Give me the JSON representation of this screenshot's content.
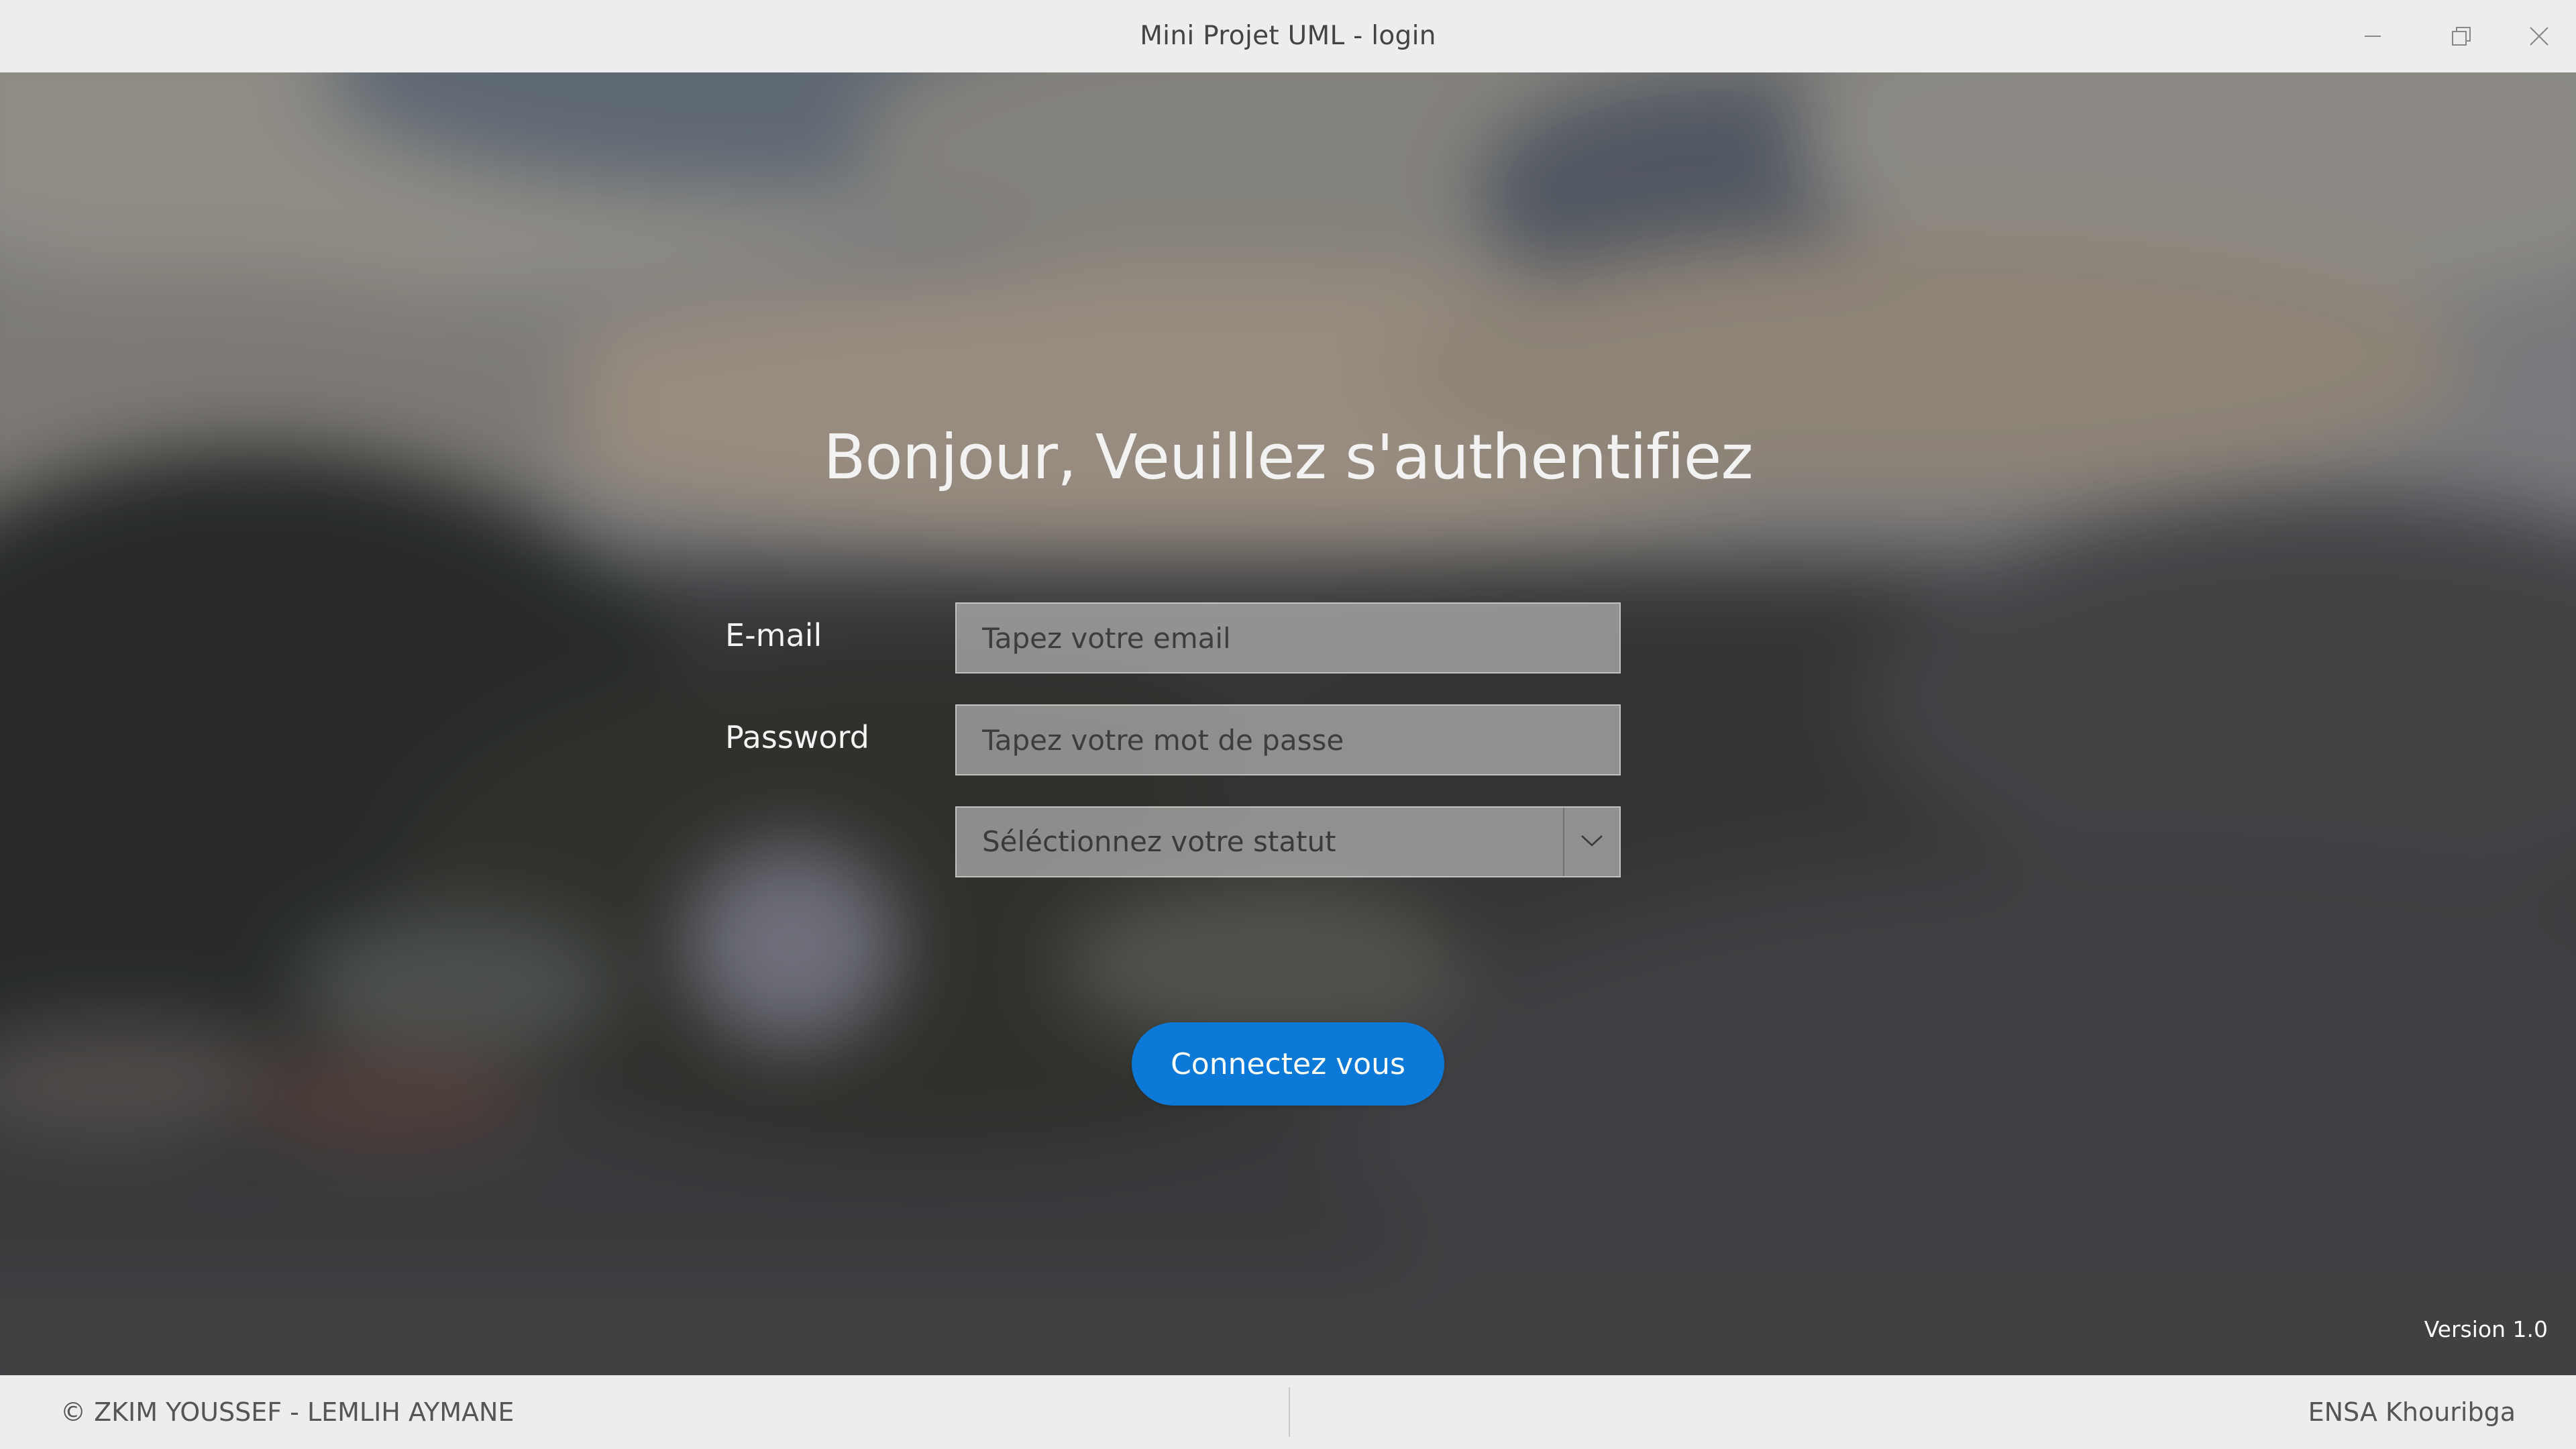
{
  "window": {
    "title": "Mini Projet UML - login",
    "controls": {
      "minimize_icon": "minimize-icon",
      "maximize_icon": "restore-icon",
      "close_icon": "close-icon"
    }
  },
  "login": {
    "heading": "Bonjour, Veuillez s'authentifiez",
    "email_label": "E-mail",
    "email_placeholder": "Tapez votre email",
    "email_value": "",
    "password_label": "Password",
    "password_placeholder": "Tapez votre mot de passe",
    "password_value": "",
    "status_select_value": "Séléctionnez votre statut",
    "connect_button": "Connectez vous"
  },
  "version": "Version 1.0",
  "statusbar": {
    "left": "© ZKIM YOUSSEF - LEMLIH AYMANE",
    "right": "ENSA Khouribga"
  },
  "colors": {
    "accent": "#0c79d8",
    "titlebar_bg": "#ededed",
    "field_bg": "#c8c8c8"
  }
}
